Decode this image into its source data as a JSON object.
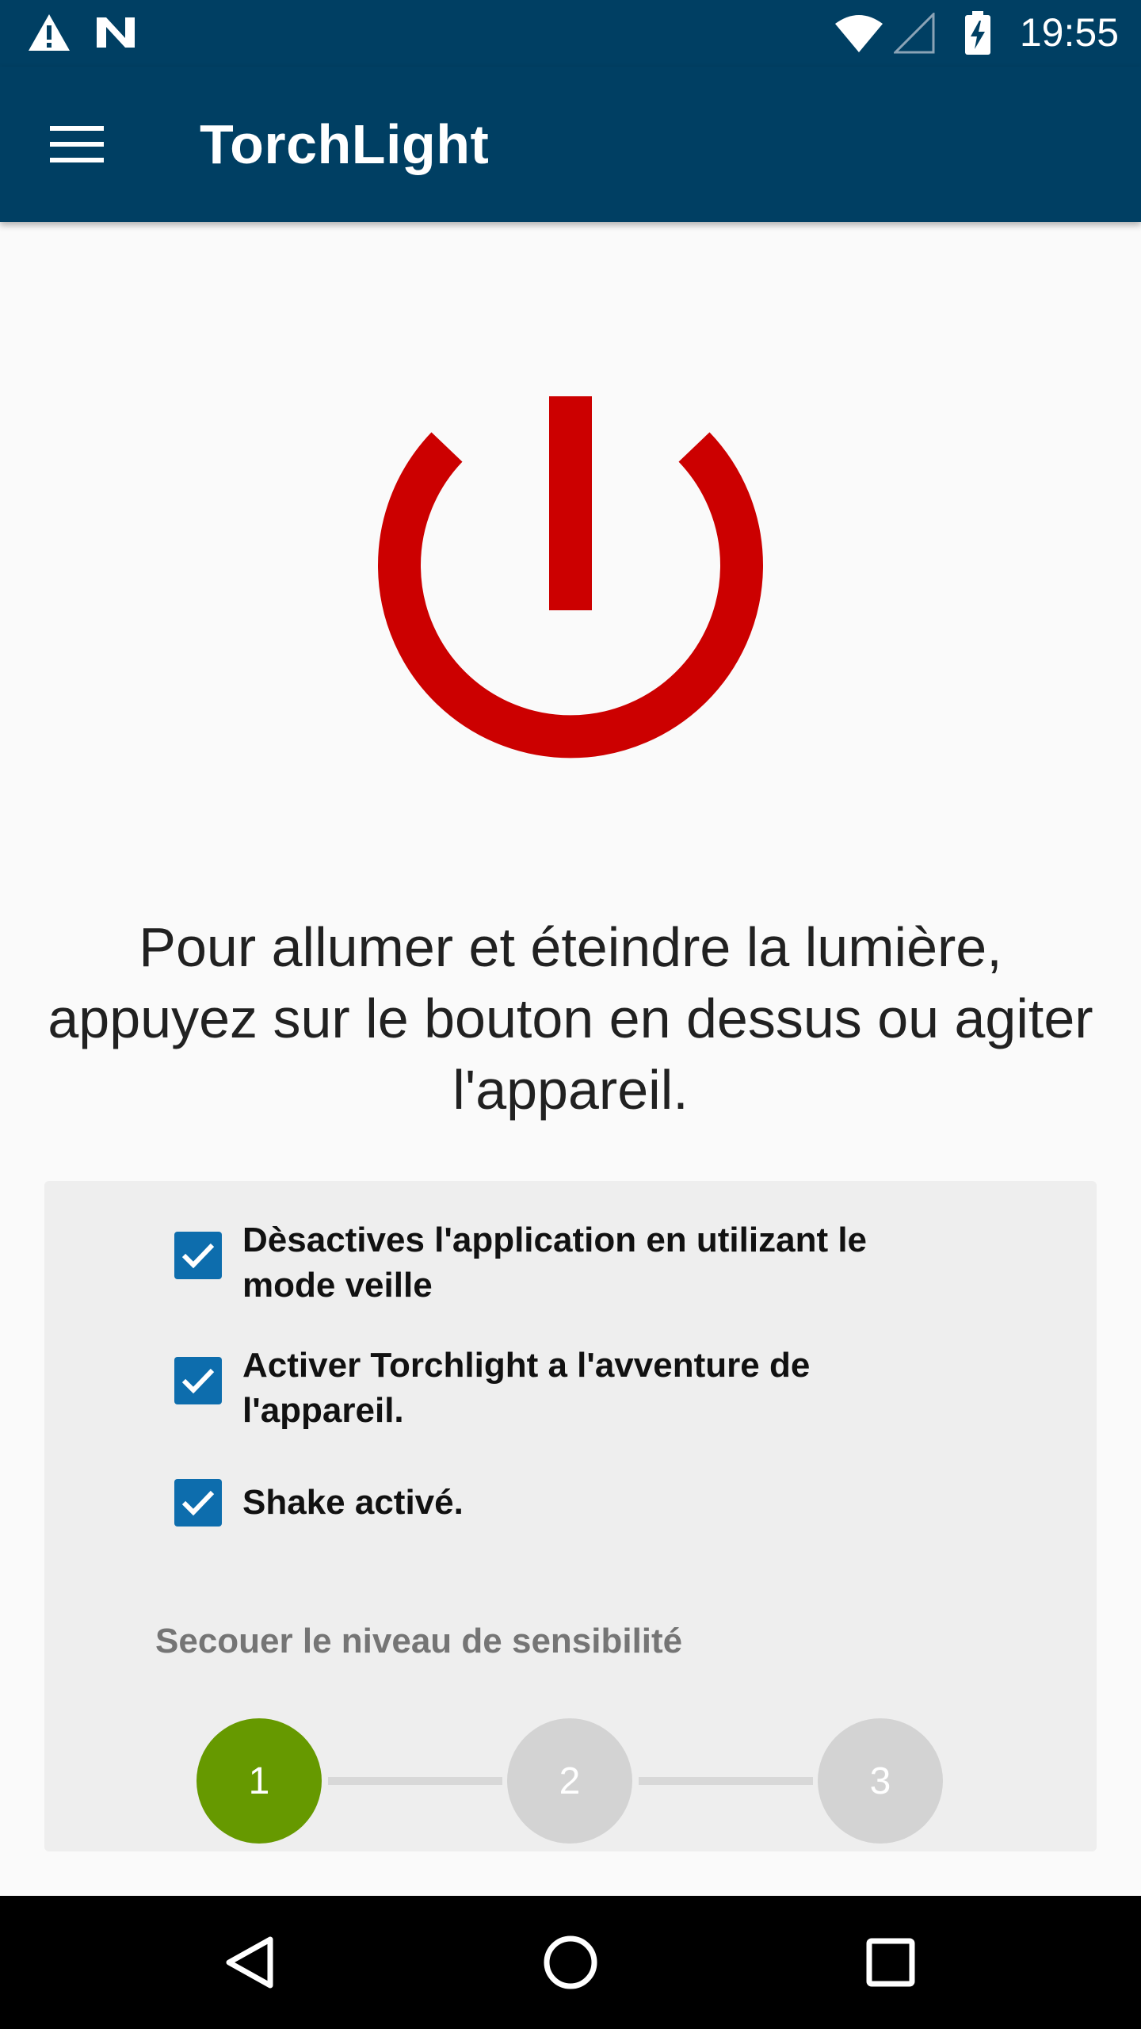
{
  "status_bar": {
    "time": "19:55",
    "icons": [
      "warning-icon",
      "n-notification-icon",
      "wifi-icon",
      "cell-signal-icon",
      "battery-charging-icon"
    ]
  },
  "app_bar": {
    "title": "TorchLight",
    "menu_icon": "hamburger-menu-icon"
  },
  "power_button": {
    "icon": "power-icon",
    "color": "#cc0000"
  },
  "instructions": {
    "text": "Pour allumer et éteindre la lumière, appuyez sur le bouton en dessus ou agiter l'appareil."
  },
  "settings": {
    "options": [
      {
        "label": "Dèsactives l'application en utilizant le mode veille",
        "checked": true
      },
      {
        "label": "Activer Torchlight a l'avventure de l'appareil.",
        "checked": true
      },
      {
        "label": "Shake activé.",
        "checked": true
      }
    ],
    "sensitivity": {
      "label": "Secouer le niveau de sensibilité",
      "steps": [
        "1",
        "2",
        "3"
      ],
      "selected": "1",
      "active_color": "#669900",
      "inactive_color": "#d3d3d3"
    }
  },
  "colors": {
    "primary": "#003f63",
    "checkbox": "#0d6dad"
  },
  "nav_bar": {
    "icons": [
      "back-icon",
      "home-icon",
      "recents-icon"
    ]
  }
}
